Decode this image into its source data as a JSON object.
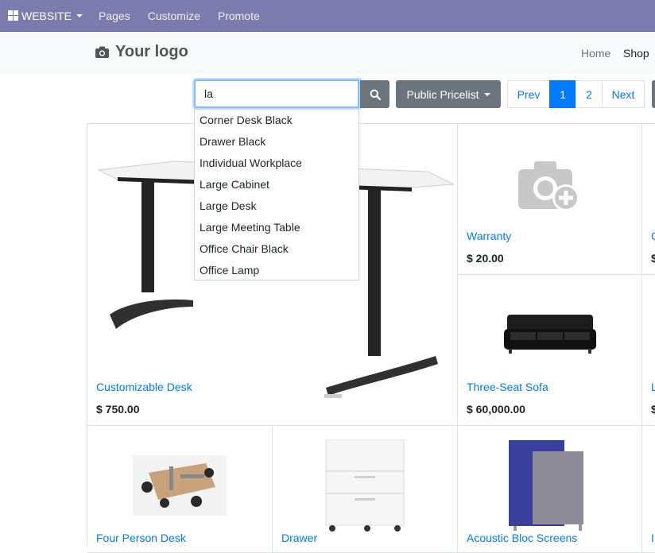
{
  "topbar": {
    "brand": "WEBSITE",
    "menu": [
      "Pages",
      "Customize",
      "Promote"
    ]
  },
  "header": {
    "logo_text": "Your logo",
    "nav": {
      "home": "Home",
      "shop": "Shop"
    }
  },
  "search": {
    "value": "la",
    "suggestions": [
      "Corner Desk Black",
      "Drawer Black",
      "Individual Workplace",
      "Large Cabinet",
      "Large Desk",
      "Large Meeting Table",
      "Office Chair Black",
      "Office Lamp"
    ]
  },
  "toolbar": {
    "pricelist": "Public Pricelist",
    "pager": {
      "prev": "Prev",
      "pages": [
        "1",
        "2"
      ],
      "next": "Next",
      "current": "1"
    }
  },
  "products": [
    {
      "name": "Customizable Desk",
      "price": "$ 750.00"
    },
    {
      "name": "Warranty",
      "price": "$ 20.00"
    },
    {
      "name": "Three-Seat Sofa",
      "price": "$ 60,000.00"
    },
    {
      "name": "Four Person Desk",
      "price": ""
    },
    {
      "name": "Drawer",
      "price": ""
    },
    {
      "name": "Acoustic Bloc Screens",
      "price": ""
    }
  ],
  "partial_column": [
    "C",
    "$",
    "L",
    "$",
    "I"
  ],
  "colors": {
    "admin_bar": "#7c7bad",
    "primary": "#007bff",
    "secondary": "#6c757d",
    "header_bg": "#f8f9fa"
  }
}
